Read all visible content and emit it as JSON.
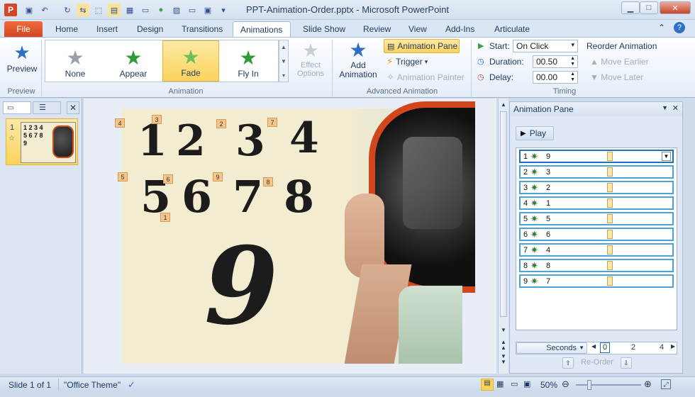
{
  "window": {
    "title": "PPT-Animation-Order.pptx - Microsoft PowerPoint",
    "app_letter": "P"
  },
  "tabs": [
    "File",
    "Home",
    "Insert",
    "Design",
    "Transitions",
    "Animations",
    "Slide Show",
    "Review",
    "View",
    "Add-Ins",
    "Articulate"
  ],
  "ribbon": {
    "preview": {
      "label": "Preview",
      "group": "Preview"
    },
    "animation_group": "Animation",
    "effects": [
      {
        "label": "None",
        "color": "#9aa0a8"
      },
      {
        "label": "Appear",
        "color": "#2e9a38"
      },
      {
        "label": "Fade",
        "color": "#2e9a38"
      },
      {
        "label": "Fly In",
        "color": "#2e9a38"
      }
    ],
    "effect_options": "Effect Options",
    "add_animation": "Add Animation",
    "animation_pane": "Animation Pane",
    "trigger": "Trigger",
    "animation_painter": "Animation Painter",
    "advanced_group": "Advanced Animation",
    "start_label": "Start:",
    "start_value": "On Click",
    "duration_label": "Duration:",
    "duration_value": "00.50",
    "delay_label": "Delay:",
    "delay_value": "00.00",
    "timing_group": "Timing",
    "reorder_title": "Reorder Animation",
    "move_earlier": "Move Earlier",
    "move_later": "Move Later"
  },
  "thumbnails": {
    "slide_number": "1",
    "preview_text": "1 2 3 4\n5 6 7 8\n9"
  },
  "slide": {
    "digits": [
      "1",
      "2",
      "3",
      "4",
      "5",
      "6",
      "7",
      "8",
      "9"
    ],
    "tags": [
      "4",
      "3",
      "2",
      "7",
      "5",
      "6",
      "9",
      "8",
      "1"
    ]
  },
  "animation_pane": {
    "title": "Animation Pane",
    "play": "Play",
    "items": [
      {
        "n": "1",
        "label": "9"
      },
      {
        "n": "2",
        "label": "3"
      },
      {
        "n": "3",
        "label": "2"
      },
      {
        "n": "4",
        "label": "1"
      },
      {
        "n": "5",
        "label": "5"
      },
      {
        "n": "6",
        "label": "6"
      },
      {
        "n": "7",
        "label": "4"
      },
      {
        "n": "8",
        "label": "8"
      },
      {
        "n": "9",
        "label": "7"
      }
    ],
    "seconds": "Seconds",
    "ticks": [
      "0",
      "2",
      "4"
    ],
    "reorder": "Re-Order"
  },
  "status": {
    "slide": "Slide 1 of 1",
    "theme": "\"Office Theme\"",
    "zoom": "50%"
  }
}
